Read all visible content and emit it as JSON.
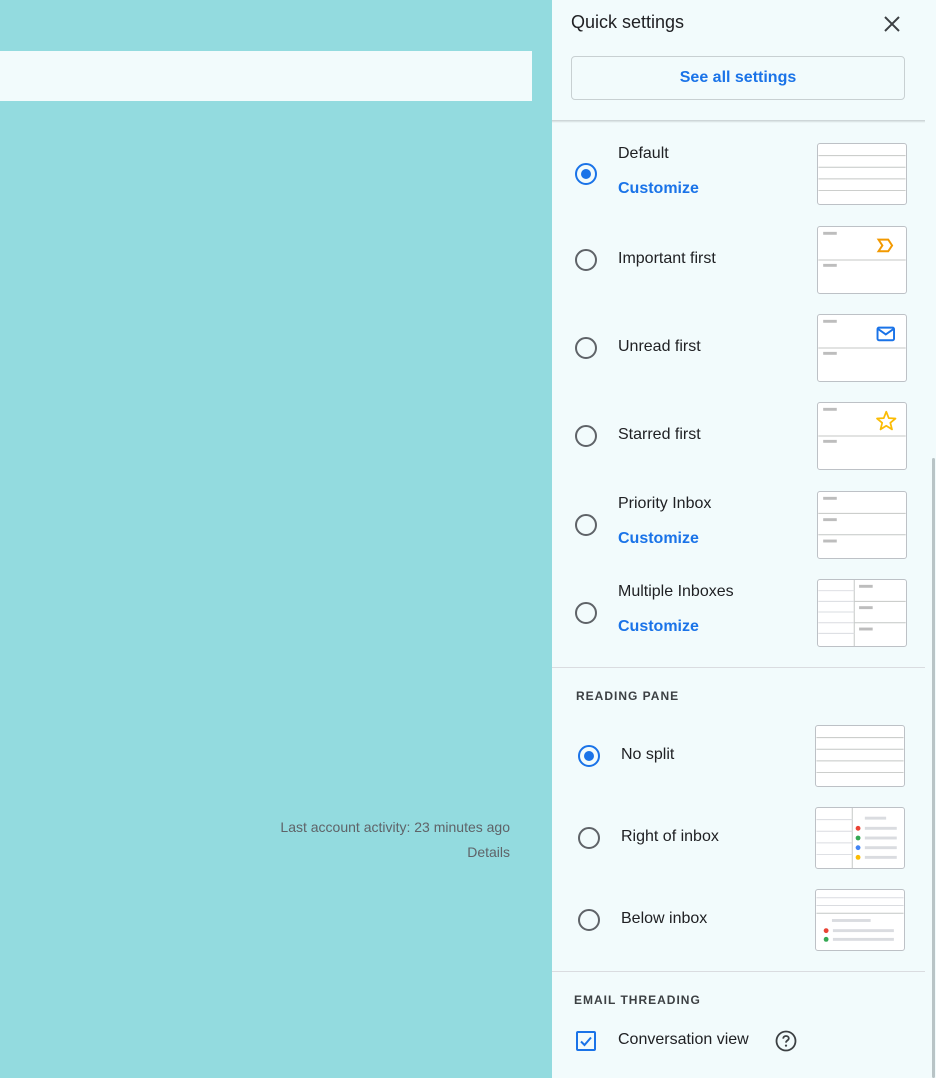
{
  "background": {
    "activity_text": "Last account activity: 23 minutes ago",
    "details_link": "Details"
  },
  "quick_settings": {
    "title": "Quick settings",
    "close_icon": "close-icon",
    "see_all_label": "See all settings",
    "inbox_types": [
      {
        "label": "Default",
        "selected": true,
        "customize": "Customize"
      },
      {
        "label": "Important first",
        "selected": false,
        "icon": "importance-marker-icon"
      },
      {
        "label": "Unread first",
        "selected": false,
        "icon": "envelope-icon"
      },
      {
        "label": "Starred first",
        "selected": false,
        "icon": "star-icon"
      },
      {
        "label": "Priority Inbox",
        "selected": false,
        "customize": "Customize"
      },
      {
        "label": "Multiple Inboxes",
        "selected": false,
        "customize": "Customize"
      }
    ],
    "reading_pane": {
      "title": "READING PANE",
      "options": [
        {
          "label": "No split",
          "selected": true
        },
        {
          "label": "Right of inbox",
          "selected": false
        },
        {
          "label": "Below inbox",
          "selected": false
        }
      ]
    },
    "email_threading": {
      "title": "EMAIL THREADING",
      "conversation_view": {
        "label": "Conversation view",
        "checked": true
      },
      "help_icon": "help-icon"
    }
  },
  "colors": {
    "background": "#93dbdf",
    "panel": "#f2fbfc",
    "accent": "#1a73e8",
    "important": "#f29900",
    "star": "#fbbc04",
    "dot_red": "#ea4335",
    "dot_green": "#34a853",
    "dot_blue": "#4285f4",
    "dot_yellow": "#fbbc04"
  }
}
